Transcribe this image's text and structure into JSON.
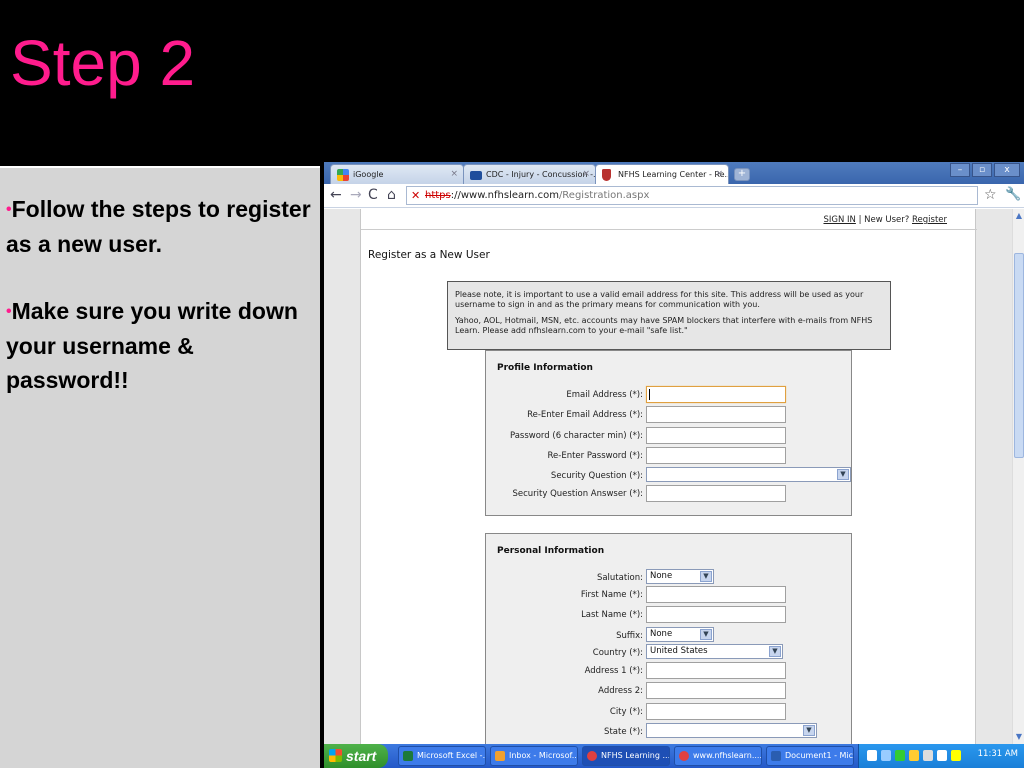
{
  "slide": {
    "title": "Step 2",
    "bullets": [
      {
        "text": "Follow the steps to register as a new user."
      },
      {
        "text": "Make sure you write down your username & password!!"
      }
    ],
    "bullet_glyph": "•",
    "accent_color": "#ff1c8d"
  },
  "browser": {
    "tabs": [
      {
        "label": "iGoogle",
        "icon": "igoogle-icon",
        "active": false
      },
      {
        "label": "CDC - Injury - Concussion -...",
        "icon": "cdc-icon",
        "active": false
      },
      {
        "label": "NFHS Learning Center - Re...",
        "icon": "nfhs-shield-icon",
        "active": true
      }
    ],
    "tab_close": "×",
    "new_tab": "+",
    "window_buttons": {
      "minimize": "–",
      "maximize": "▫",
      "close": "x"
    },
    "nav": {
      "back": "←",
      "forward": "→",
      "reload": "C",
      "home": "⌂"
    },
    "address": {
      "scheme": "https",
      "sep": "://",
      "host": "www.nfhslearn.com",
      "path": "/Registration.aspx",
      "security_mark": "✕"
    },
    "star": "☆",
    "wrench": "🔧"
  },
  "page": {
    "signin": {
      "link": "SIGN IN",
      "sep": " | New User? ",
      "register": "Register"
    },
    "heading": "Register as a New User",
    "notice": [
      "Please note, it is important to use a valid email address for this site. This address will be used as your username to sign in and as the primary means for communication with you.",
      "Yahoo, AOL, Hotmail, MSN, etc. accounts may have SPAM blockers that interfere with e-mails from NFHS Learn. Please add nfhslearn.com to your e-mail \"safe list.\""
    ],
    "profile": {
      "title": "Profile Information",
      "fields": [
        {
          "label": "Email Address (*):",
          "value": ""
        },
        {
          "label": "Re-Enter Email Address (*):",
          "value": ""
        },
        {
          "label": "Password (6 character min) (*):",
          "value": ""
        },
        {
          "label": "Re-Enter Password (*):",
          "value": ""
        },
        {
          "label": "Security Question (*):",
          "value": ""
        },
        {
          "label": "Security Question Answser (*):",
          "value": ""
        }
      ]
    },
    "personal": {
      "title": "Personal Information",
      "fields": [
        {
          "label": "Salutation:",
          "value": "None"
        },
        {
          "label": "First Name (*):",
          "value": ""
        },
        {
          "label": "Last Name (*):",
          "value": ""
        },
        {
          "label": "Suffix:",
          "value": "None"
        },
        {
          "label": "Country (*):",
          "value": "United States"
        },
        {
          "label": "Address 1 (*):",
          "value": ""
        },
        {
          "label": "Address 2:",
          "value": ""
        },
        {
          "label": "City (*):",
          "value": ""
        },
        {
          "label": "State (*):",
          "value": ""
        }
      ]
    },
    "dropdown_arrow": "▼"
  },
  "scrollbar": {
    "up": "▲",
    "down": "▼"
  },
  "taskbar": {
    "start": "start",
    "tasks": [
      {
        "label": "Microsoft Excel -...",
        "color": "#1d7a3a"
      },
      {
        "label": "Inbox - Microsof...",
        "color": "#f0a030"
      },
      {
        "label": "NFHS Learning ...",
        "color": "#e04040"
      },
      {
        "label": "www.nfhslearn....",
        "color": "#e04040"
      },
      {
        "label": "Document1 - Mic...",
        "color": "#2a5db0"
      }
    ],
    "clock": "11:31 AM"
  }
}
